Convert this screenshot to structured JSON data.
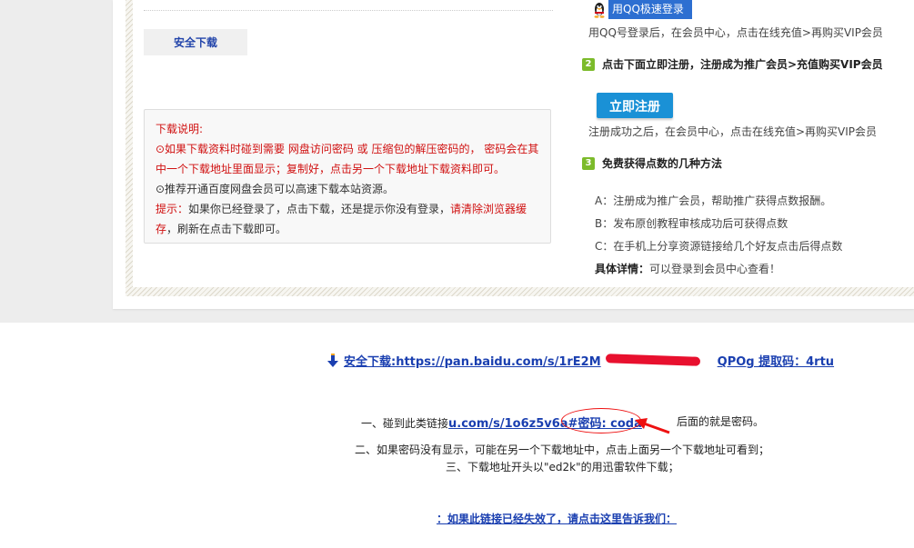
{
  "left_panel": {
    "secure_download_button": "安全下载",
    "note": {
      "title": "下载说明:",
      "line1": "⊙如果下载资料时碰到需要 网盘访问密码 或 压缩包的解压密码的， 密码会在其",
      "line2": "中一个下载地址里面显示；复制好，点击另一个下载地址下载资料即可。",
      "line3": "⊙推荐开通百度网盘会员可以高速下载本站资源。",
      "tip_label": "提示：",
      "tip_text_a": "如果你已经登录了，点击下载，还是提示你没有登录，",
      "tip_text_red": "请清除浏览器缓",
      "tip_text_b": "存",
      "tip_text_c": "，刷新在点击下载即可。"
    }
  },
  "right_panel": {
    "qq_login_button": "用QQ极速登录",
    "qq_desc": "用QQ号登录后，在会员中心，点击在线充值>再购买VIP会员",
    "step2": {
      "num": "2",
      "text": "点击下面立即注册，注册成为推广会员>充值购买VIP会员"
    },
    "register_button": "立即注册",
    "register_desc": "注册成功之后，在会员中心，点击在线充值>再购买VIP会员",
    "step3": {
      "num": "3",
      "text": "免费获得点数的几种方法"
    },
    "ways": [
      "A：注册成为推广会员，帮助推广获得点数报酬。",
      "B：发布原创教程审核成功后可获得点数",
      "C：在手机上分享资源链接给几个好友点击后得点数"
    ],
    "detail_label": "具体详情：",
    "detail_text": "可以登录到会员中心查看！"
  },
  "bottom": {
    "download_link_text": "安全下载:https://pan.baidu.com/s/1rE2M",
    "download_link_tail": "QPOg 提取码：4rtu",
    "example_prefix": "一、碰到此类链接",
    "example_link": "u.com/s/1o6z5v6a#密码: coda",
    "example_suffix": "后面的就是密码。",
    "line2": "二、如果密码没有显示，可能在另一个下载地址中，点击上面另一个下载地址可看到；",
    "line3": "三、下载地址开头以\"ed2k\"的用迅雷软件下载；",
    "report_link": "：如果此链接已经失效了，请点击这里告诉我们："
  },
  "colors": {
    "accent_blue": "#1a3fb0",
    "register_blue": "#1a91d6",
    "note_red": "#d01010",
    "step_green": "#7cbb2b"
  }
}
